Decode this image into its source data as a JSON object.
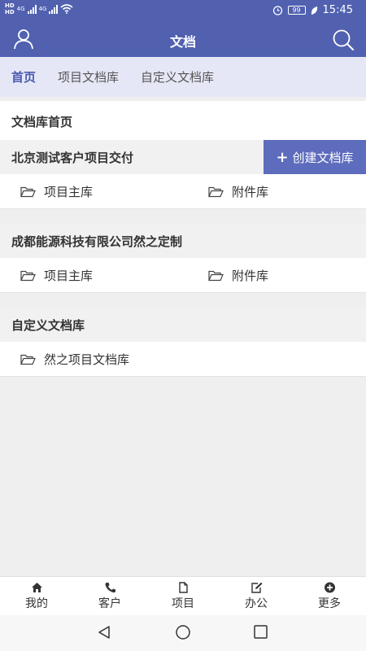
{
  "status_bar": {
    "network_labels": [
      "HD",
      "HD"
    ],
    "signal": [
      "4G",
      "4G"
    ],
    "battery": "99",
    "time": "15:45"
  },
  "app_bar": {
    "title": "文档",
    "left_icon": "user-icon",
    "right_icon": "search-icon"
  },
  "tabs": [
    {
      "label": "首页",
      "active": true
    },
    {
      "label": "项目文档库",
      "active": false
    },
    {
      "label": "自定义文档库",
      "active": false
    }
  ],
  "home_title": "文档库首页",
  "create_button": {
    "icon": "plus-icon",
    "label": "创建文档库"
  },
  "sections": [
    {
      "title": "北京测试客户项目交付",
      "items": [
        "项目主库",
        "附件库"
      ]
    },
    {
      "title": "成都能源科技有限公司然之定制",
      "items": [
        "项目主库",
        "附件库"
      ]
    },
    {
      "title": "自定义文档库",
      "items": [
        "然之项目文档库"
      ]
    }
  ],
  "bottom_nav": [
    {
      "label": "我的",
      "icon": "home-icon"
    },
    {
      "label": "客户",
      "icon": "phone-icon"
    },
    {
      "label": "项目",
      "icon": "file-icon"
    },
    {
      "label": "办公",
      "icon": "edit-icon"
    },
    {
      "label": "更多",
      "icon": "plus-circle-icon"
    }
  ],
  "colors": {
    "primary": "#5161b0",
    "tab_bg": "#e6e7f6",
    "button": "#5d6cbc",
    "active_tab": "#4a5bb0"
  }
}
